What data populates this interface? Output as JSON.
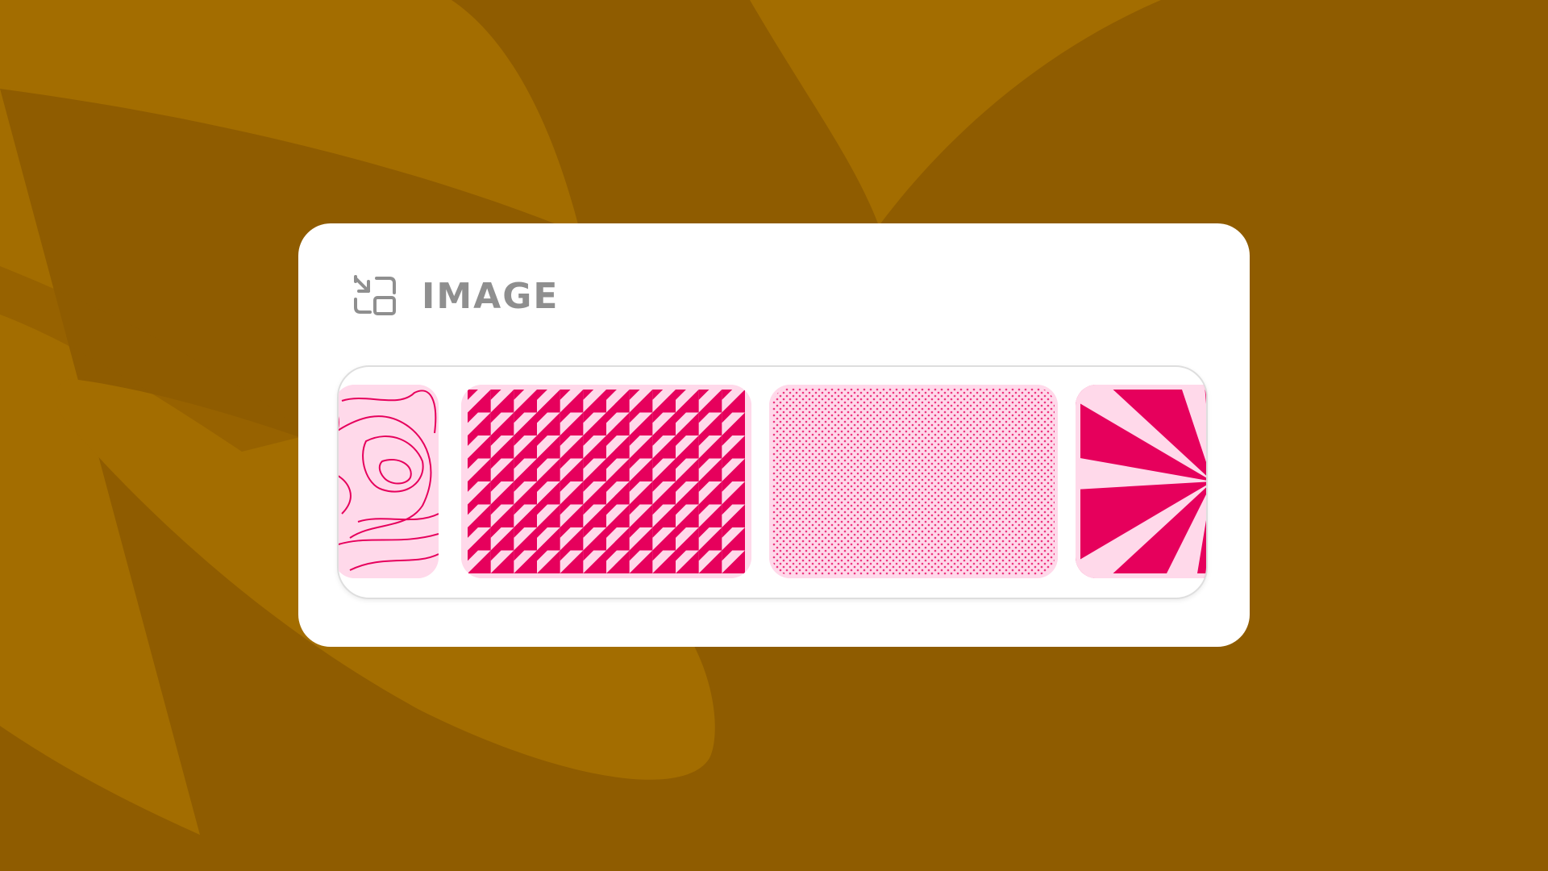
{
  "panel": {
    "title": "IMAGE",
    "icon": "swap-image-icon"
  },
  "carousel": {
    "items": [
      {
        "pattern": "topographic-lines"
      },
      {
        "pattern": "triangle-grid"
      },
      {
        "pattern": "dot-halftone"
      },
      {
        "pattern": "sunburst-rays"
      }
    ]
  },
  "colors": {
    "background": "#a36d00",
    "background_dark": "#8f5c00",
    "accent": "#e6005c",
    "pattern_light": "#ffd9ea",
    "title": "#8f8f8f"
  }
}
